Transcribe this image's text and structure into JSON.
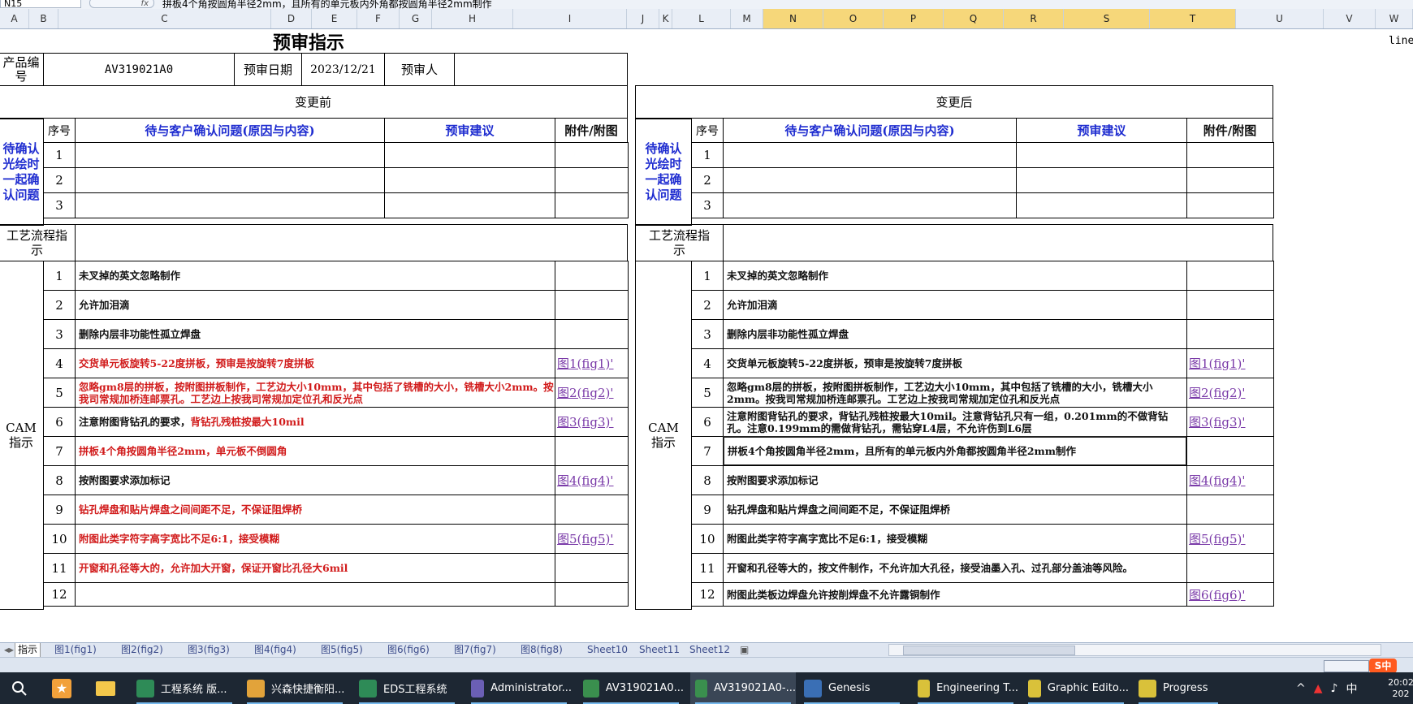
{
  "formula_bar": {
    "name_box": "N15",
    "fx": "fx",
    "formula": "拼板4个角按圆角半径2mm，且所有的单元板内外角都按圆角半径2mm制作"
  },
  "columns": [
    "A",
    "B",
    "C",
    "D",
    "E",
    "F",
    "G",
    "H",
    "I",
    "J",
    "K",
    "L",
    "M",
    "N",
    "O",
    "P",
    "Q",
    "R",
    "S",
    "T",
    "U",
    "V",
    "W"
  ],
  "sheet": {
    "title": "预审指示",
    "stray_text": "line",
    "info": {
      "product_label": "产品编号",
      "product_value": "AV319021A0",
      "date_label": "预审日期",
      "date_value": "2023/12/21",
      "reviewer_label": "预审人"
    },
    "before": {
      "header": "变更前",
      "confirm_side_label": "待确认光绘时一起确认问题",
      "col_seq": "序号",
      "col_issue": "待与客户确认问题(原因与内容)",
      "col_suggest": "预审建议",
      "col_attach": "附件/附图",
      "confirm_rows": [
        "1",
        "2",
        "3"
      ],
      "process_label": "工艺流程指示",
      "cam_label": "CAM指示",
      "items": [
        {
          "n": "1",
          "text": "未叉掉的英文忽略制作",
          "style": "dark",
          "link": ""
        },
        {
          "n": "2",
          "text": "允许加泪滴",
          "style": "dark",
          "link": ""
        },
        {
          "n": "3",
          "text": "删除内层非功能性孤立焊盘",
          "style": "dark",
          "link": ""
        },
        {
          "n": "4",
          "text": "交货单元板旋转5-22度拼板，预审是按旋转7度拼板",
          "style": "red",
          "link": "图1(fig1)'"
        },
        {
          "n": "5",
          "text": "忽略gm8层的拼板，按附图拼板制作，工艺边大小10mm，其中包括了铣槽的大小，铣槽大小2mm。按我司常规加桥连邮票孔。工艺边上按我司常规加定位孔和反光点",
          "style": "red",
          "link": "图2(fig2)'"
        },
        {
          "n": "6",
          "text": "注意附图背钻孔的要求，背钻孔残桩按最大10mil",
          "style": "mixed",
          "link": "图3(fig3)'"
        },
        {
          "n": "7",
          "text": "拼板4个角按圆角半径2mm，单元板不倒圆角",
          "style": "red",
          "link": ""
        },
        {
          "n": "8",
          "text": "按附图要求添加标记",
          "style": "dark",
          "link": "图4(fig4)'"
        },
        {
          "n": "9",
          "text": "钻孔焊盘和贴片焊盘之间间距不足，不保证阻焊桥",
          "style": "red",
          "link": ""
        },
        {
          "n": "10",
          "text": "附图此类字符字高字宽比不足6:1，接受模糊",
          "style": "red",
          "link": "图5(fig5)'"
        },
        {
          "n": "11",
          "text": "开窗和孔径等大的，允许加大开窗，保证开窗比孔径大6mil",
          "style": "red",
          "link": ""
        },
        {
          "n": "12",
          "text": "",
          "style": "dark",
          "link": ""
        }
      ],
      "item6_black": "注意附图背钻孔的要求，",
      "item6_red": "背钻孔残桩按最大10mil"
    },
    "after": {
      "header": "变更后",
      "confirm_side_label": "待确认光绘时一起确认问题",
      "col_seq": "序号",
      "col_issue": "待与客户确认问题(原因与内容)",
      "col_suggest": "预审建议",
      "col_attach": "附件/附图",
      "confirm_rows": [
        "1",
        "2",
        "3"
      ],
      "process_label": "工艺流程指示",
      "cam_label": "CAM指示",
      "items": [
        {
          "n": "1",
          "text": "未叉掉的英文忽略制作",
          "link": ""
        },
        {
          "n": "2",
          "text": "允许加泪滴",
          "link": ""
        },
        {
          "n": "3",
          "text": "删除内层非功能性孤立焊盘",
          "link": ""
        },
        {
          "n": "4",
          "text": "交货单元板旋转5-22度拼板，预审是按旋转7度拼板",
          "link": "图1(fig1)'"
        },
        {
          "n": "5",
          "text": "忽略gm8层的拼板，按附图拼板制作，工艺边大小10mm，其中包括了铣槽的大小，铣槽大小2mm。按我司常规加桥连邮票孔。工艺边上按我司常规加定位孔和反光点",
          "link": "图2(fig2)'"
        },
        {
          "n": "6",
          "text": "注意附图背钻孔的要求，背钻孔残桩按最大10mil。注意背钻孔只有一组，0.201mm的不做背钻孔。注意0.199mm的需做背钻孔，需钻穿L4层，不允许伤到L6层",
          "link": "图3(fig3)'"
        },
        {
          "n": "7",
          "text": "拼板4个角按圆角半径2mm，且所有的单元板内外角都按圆角半径2mm制作",
          "link": ""
        },
        {
          "n": "8",
          "text": "按附图要求添加标记",
          "link": "图4(fig4)'"
        },
        {
          "n": "9",
          "text": "钻孔焊盘和贴片焊盘之间间距不足，不保证阻焊桥",
          "link": ""
        },
        {
          "n": "10",
          "text": "附图此类字符字高字宽比不足6:1，接受模糊",
          "link": "图5(fig5)'"
        },
        {
          "n": "11",
          "text": "开窗和孔径等大的，按文件制作，不允许加大孔径，接受油墨入孔、过孔部分盖油等风险。",
          "link": ""
        },
        {
          "n": "12",
          "text": "附图此类板边焊盘允许按削焊盘不允许露铜制作",
          "link": "图6(fig6)'"
        }
      ]
    }
  },
  "tabs": [
    "指示",
    "图1(fig1)",
    "图2(fig2)",
    "图3(fig3)",
    "图4(fig4)",
    "图5(fig5)",
    "图6(fig6)",
    "图7(fig7)",
    "图8(fig8)",
    "Sheet10",
    "Sheet11",
    "Sheet12"
  ],
  "tray": {
    "ime": "中",
    "time": "20:02",
    "date": "202"
  },
  "taskbar": [
    {
      "label": "工程系统  版...",
      "color": "#2e8b57"
    },
    {
      "label": "兴森快捷衡阳...",
      "color": "#e2a33a"
    },
    {
      "label": "EDS工程系统",
      "color": "#2e8b57"
    },
    {
      "label": "Administrator...",
      "color": "#6b5fb5"
    },
    {
      "label": "AV319021A0...",
      "color": "#3a8f4e"
    },
    {
      "label": "AV319021A0-...",
      "color": "#3a8f4e"
    },
    {
      "label": "Genesis",
      "color": "#3a6fb5"
    },
    {
      "label": "Engineering T...",
      "color": "#d9c13a"
    },
    {
      "label": "Graphic Edito...",
      "color": "#d9c13a"
    },
    {
      "label": "Progress",
      "color": "#d9c13a"
    }
  ]
}
